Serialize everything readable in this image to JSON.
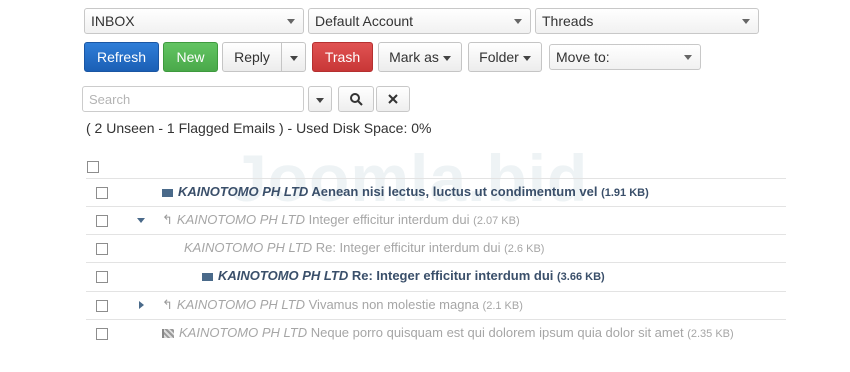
{
  "toolbar": {
    "folder_select": "INBOX",
    "account_select": "Default Account",
    "view_select": "Threads",
    "refresh": "Refresh",
    "new": "New",
    "reply": "Reply",
    "trash": "Trash",
    "mark_as": "Mark as",
    "folder": "Folder",
    "move_to": "Move to:"
  },
  "search": {
    "placeholder": "Search"
  },
  "status_text": "( 2 Unseen - 1 Flagged Emails ) - Used Disk Space: 0%",
  "watermark": "Joomla.bid",
  "messages": [
    {
      "sender": "KAINOTOMO PH LTD",
      "subject": "Aenean nisi lectus, luctus ut condimentum vel",
      "size": "(1.91 KB)",
      "state": "unread"
    },
    {
      "sender": "KAINOTOMO PH LTD",
      "subject": "Integer efficitur interdum dui",
      "size": "(2.07 KB)",
      "state": "read"
    },
    {
      "sender": "KAINOTOMO PH LTD",
      "subject": "Re: Integer efficitur interdum dui",
      "size": "(2.6 KB)",
      "state": "read"
    },
    {
      "sender": "KAINOTOMO PH LTD",
      "subject": "Re: Integer efficitur interdum dui",
      "size": "(3.66 KB)",
      "state": "unread"
    },
    {
      "sender": "KAINOTOMO PH LTD",
      "subject": "Vivamus non molestie magna",
      "size": "(2.1 KB)",
      "state": "read"
    },
    {
      "sender": "KAINOTOMO PH LTD",
      "subject": "Neque porro quisquam est qui dolorem ipsum quia dolor sit amet",
      "size": "(2.35 KB)",
      "state": "flagged"
    }
  ],
  "colors": {
    "primary": "#1b5fb5",
    "success": "#4aa94a",
    "danger": "#c83737",
    "unread_text": "#3a4f6a",
    "read_text": "#a6a6a6"
  }
}
